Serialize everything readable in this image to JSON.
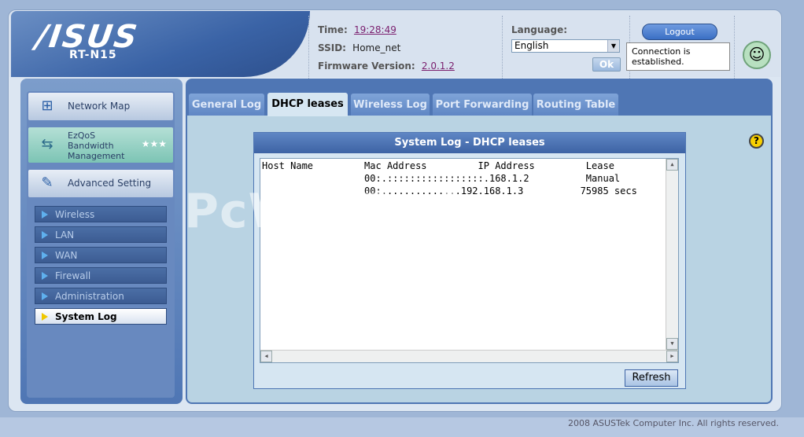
{
  "header": {
    "brand": "/ISUS",
    "model": "RT-N15",
    "time_label": "Time:",
    "time_value": "19:28:49",
    "ssid_label": "SSID:",
    "ssid_value": "Home_net",
    "firmware_label": "Firmware Version:",
    "firmware_value": "2.0.1.2",
    "language_label": "Language:",
    "language_value": "English",
    "ok_label": "Ok",
    "logout_label": "Logout",
    "status_line1": "Connection is",
    "status_line2": "established."
  },
  "sidebar": {
    "network_map": "Network Map",
    "qos_line1": "EzQoS",
    "qos_line2": "Bandwidth",
    "qos_line3": "Management",
    "advanced": "Advanced Setting",
    "items": [
      "Wireless",
      "LAN",
      "WAN",
      "Firewall",
      "Administration",
      "System Log"
    ]
  },
  "tabs": [
    "General Log",
    "DHCP leases",
    "Wireless Log",
    "Port Forwarding",
    "Routing Table"
  ],
  "log": {
    "title": "System Log - DHCP leases",
    "lines": [
      "Host Name         Mac Address         IP Address         Lease",
      "                  00:.:::::::::::::::::.168.1.2          Manual",
      "                  00:..............192.168.1.3          75985 secs"
    ]
  },
  "refresh_label": "Refresh",
  "footer": "2008 ASUSTek Computer Inc. All rights reserved.",
  "watermark": "PcWinTech.com"
}
